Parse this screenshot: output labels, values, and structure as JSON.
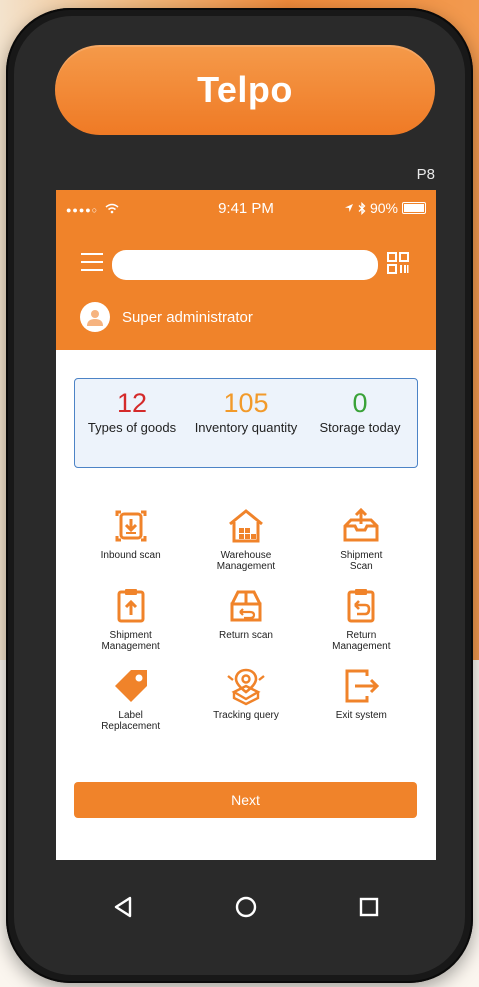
{
  "device": {
    "brand": "Telpo",
    "model": "P8"
  },
  "status_bar": {
    "signal": "●●●●○",
    "time": "9:41 PM",
    "battery": "90%",
    "battery_level": 0.9
  },
  "header": {
    "user_name": "Super administrator",
    "search_value": "",
    "search_placeholder": ""
  },
  "stats": [
    {
      "value": "12",
      "label": "Types of goods",
      "color": "#d42a2a"
    },
    {
      "value": "105",
      "label": "Inventory quantity",
      "color": "#f29a2a"
    },
    {
      "value": "0",
      "label": "Storage today",
      "color": "#3aa238"
    }
  ],
  "menu": [
    {
      "label": "Inbound scan",
      "icon": "inbound-scan-icon"
    },
    {
      "label": "Warehouse\nManagement",
      "icon": "warehouse-icon"
    },
    {
      "label": "Shipment\nScan",
      "icon": "shipment-scan-icon"
    },
    {
      "label": "Shipment\nManagement",
      "icon": "shipment-management-icon"
    },
    {
      "label": "Return scan",
      "icon": "return-scan-icon"
    },
    {
      "label": "Return\nManagement",
      "icon": "return-management-icon"
    },
    {
      "label": "Label\nReplacement",
      "icon": "label-tag-icon"
    },
    {
      "label": "Tracking query",
      "icon": "tracking-icon"
    },
    {
      "label": "Exit system",
      "icon": "exit-icon"
    }
  ],
  "next_label": "Next",
  "colors": {
    "accent": "#f0832a",
    "stats_border": "#4c83c6"
  }
}
